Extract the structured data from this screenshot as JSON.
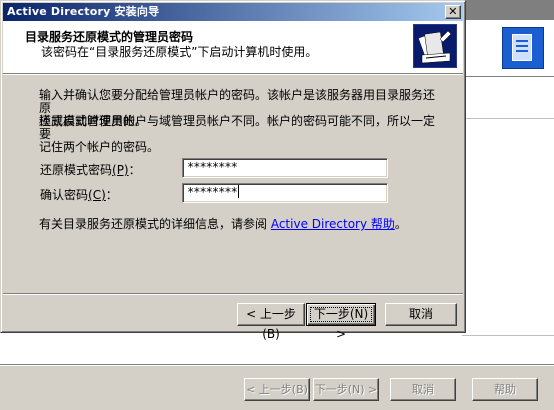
{
  "dialog": {
    "title": "Active Directory 安装向导",
    "close_glyph": "✕"
  },
  "header": {
    "title": "目录服务还原模式的管理员密码",
    "subtitle": "该密码在“目录服务还原模式”下启动计算机时使用。",
    "icon": "wizard-key-icon"
  },
  "body": {
    "para1_line1": "输入并确认您要分配给管理员帐户的密码。该帐户是该服务器用目录服务还原",
    "para1_line2": "模式启动时使用的。",
    "para2_line1": "还原模式管理员帐户与域管理员帐户不同。帐户的密码可能不同，所以一定要",
    "para2_line2": "记住两个帐户的密码。"
  },
  "fields": {
    "restore_label": "还原模式密码",
    "restore_mnemonic": "(P)",
    "restore_colon": "：",
    "restore_value": "********",
    "confirm_label": "确认密码",
    "confirm_mnemonic": "(C)",
    "confirm_colon": "：",
    "confirm_value": "********"
  },
  "info": {
    "prefix": "有关目录服务还原模式的详细信息，请参阅 ",
    "link": "Active Directory 帮助",
    "suffix": "。"
  },
  "buttons": {
    "back": "< 上一步(B)",
    "next": "下一步(N) >",
    "cancel": "取消"
  },
  "background_window": {
    "back": "< 上一步(B)",
    "next": "下一步(N) >",
    "cancel": "取消",
    "help": "帮助"
  },
  "colors": {
    "title_gradient_start": "#0a246a",
    "title_gradient_end": "#a6caf0",
    "face": "#d4d0c8",
    "link": "#0000ff"
  }
}
